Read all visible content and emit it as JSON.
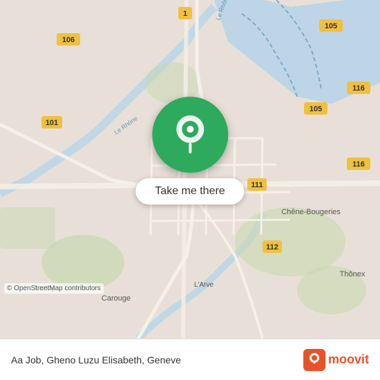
{
  "map": {
    "attribution": "© OpenStreetMap contributors"
  },
  "popup": {
    "button_label": "Take me there",
    "pin_icon": "📍"
  },
  "info_bar": {
    "location_text": "Aa Job, Gheno Luzu Elisabeth, Geneve",
    "moovit_label": "moovit"
  }
}
